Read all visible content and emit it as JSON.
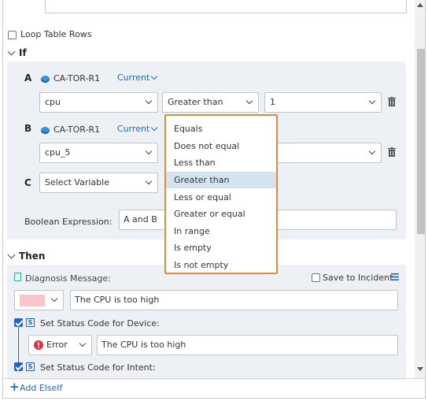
{
  "loop_table_rows": {
    "label": "Loop Table Rows",
    "checked": false
  },
  "if_section": {
    "title": "If",
    "rows": [
      {
        "letter": "A",
        "device": "CA-TOR-R1",
        "mode": "Current",
        "variable": "cpu",
        "operator": "Greater than",
        "value": "1"
      },
      {
        "letter": "B",
        "device": "CA-TOR-R1",
        "mode": "Current",
        "variable": "cpu_5"
      },
      {
        "letter": "C",
        "variable": "Select Variable"
      }
    ],
    "boolean_label": "Boolean Expression:",
    "boolean_value": "A and B"
  },
  "operator_dropdown": {
    "options": [
      "Equals",
      "Does not equal",
      "Less than",
      "Greater than",
      "Less or equal",
      "Greater or equal",
      "In range",
      "Is empty",
      "Is not empty"
    ],
    "selected": "Greater than",
    "border_color": "#e6883a"
  },
  "then_section": {
    "title": "Then",
    "diagnosis_label": "Diagnosis Message:",
    "save_to_incident_label": "Save to Incident",
    "color_swatch": "#f8c5cb",
    "message": "The CPU is too high",
    "status_device_label": "Set Status Code for Device:",
    "status_level": "Error",
    "status_message": "The CPU is too high",
    "status_intent_label": "Set Status Code for Intent:"
  },
  "add_elseif_label": "Add ElseIf",
  "colors": {
    "accent": "#1f67c1",
    "panel": "#edf1f5",
    "error": "#d9333f"
  }
}
